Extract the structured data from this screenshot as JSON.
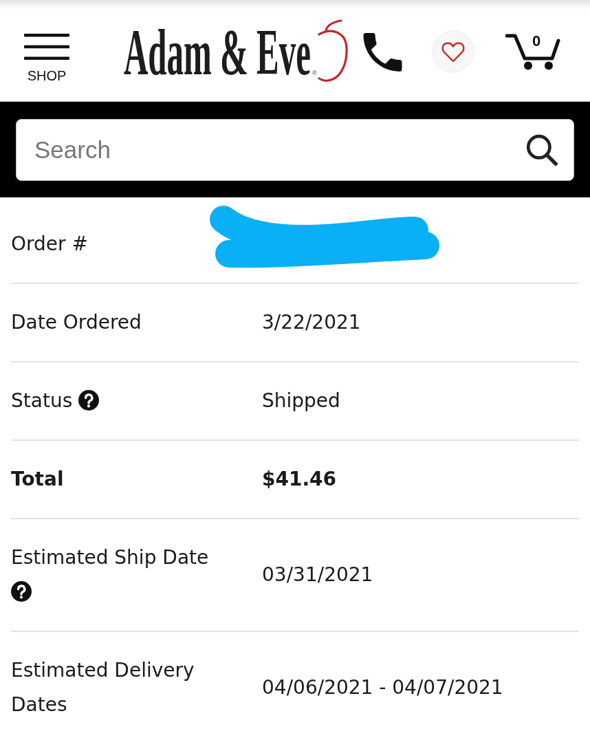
{
  "header": {
    "menu": {
      "label": "SHOP"
    },
    "logo": {
      "text": "Adam & Eve",
      "mark": "®"
    },
    "cart": {
      "count": "0"
    }
  },
  "search": {
    "placeholder": "Search"
  },
  "order_details": [
    {
      "label": "Order #",
      "kind": "line",
      "redacted": true,
      "help": false
    },
    {
      "label": "Date Ordered",
      "value": "3/22/2021",
      "kind": "line",
      "redacted": false,
      "help": false
    },
    {
      "label": "Status",
      "value": "Shipped",
      "kind": "line",
      "redacted": false,
      "help": true
    },
    {
      "label": "Total",
      "value": "$41.46",
      "kind": "total",
      "redacted": false,
      "help": false
    },
    {
      "label": "Estimated Ship Date",
      "value": "03/31/2021",
      "kind": "line",
      "redacted": false,
      "help": true
    },
    {
      "label": "Estimated Delivery Dates",
      "value": "04/06/2021 - 04/07/2021",
      "kind": "line",
      "redacted": false,
      "help": false
    }
  ]
}
